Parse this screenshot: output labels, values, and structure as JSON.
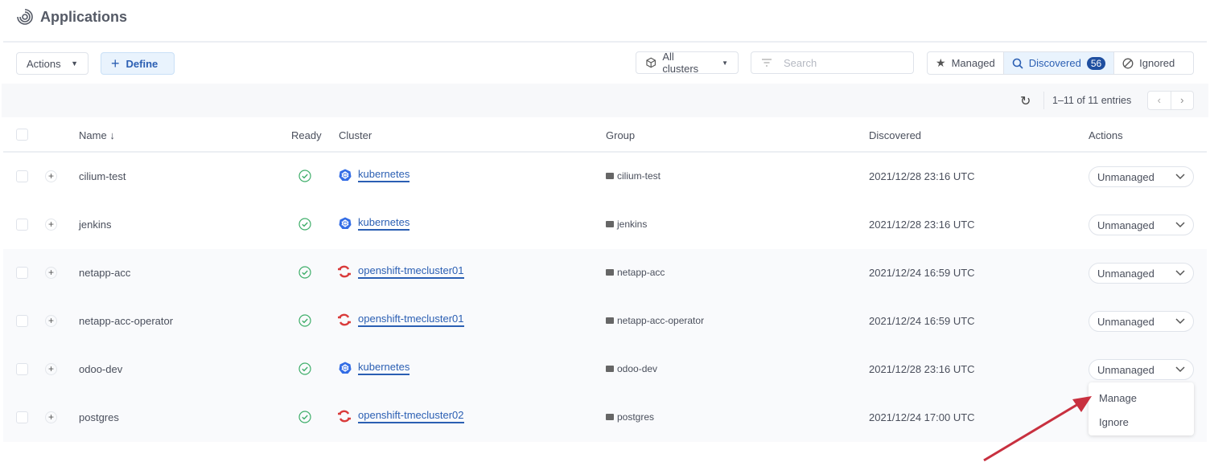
{
  "header": {
    "title": "Applications"
  },
  "toolbar": {
    "actions_label": "Actions",
    "define_label": "Define",
    "cluster_filter": "All clusters",
    "search_placeholder": "Search"
  },
  "tabs": [
    {
      "label": "Managed"
    },
    {
      "label": "Discovered",
      "count": "56"
    },
    {
      "label": "Ignored"
    }
  ],
  "pagination": {
    "entries": "1–11 of 11 entries"
  },
  "columns": {
    "name": "Name",
    "ready": "Ready",
    "cluster": "Cluster",
    "group": "Group",
    "discovered": "Discovered",
    "actions": "Actions"
  },
  "rows": [
    {
      "name": "cilium-test",
      "cluster": "kubernetes",
      "cluster_type": "kubernetes",
      "group": "cilium-test",
      "discovered": "2021/12/28 23:16 UTC",
      "action": "Unmanaged"
    },
    {
      "name": "jenkins",
      "cluster": "kubernetes",
      "cluster_type": "kubernetes",
      "group": "jenkins",
      "discovered": "2021/12/28 23:16 UTC",
      "action": "Unmanaged"
    },
    {
      "name": "netapp-acc",
      "cluster": "openshift-tmecluster01",
      "cluster_type": "openshift",
      "group": "netapp-acc",
      "discovered": "2021/12/24 16:59 UTC",
      "action": "Unmanaged"
    },
    {
      "name": "netapp-acc-operator",
      "cluster": "openshift-tmecluster01",
      "cluster_type": "openshift",
      "group": "netapp-acc-operator",
      "discovered": "2021/12/24 16:59 UTC",
      "action": "Unmanaged"
    },
    {
      "name": "odoo-dev",
      "cluster": "kubernetes",
      "cluster_type": "kubernetes",
      "group": "odoo-dev",
      "discovered": "2021/12/28 23:16 UTC",
      "action": "Unmanaged"
    },
    {
      "name": "postgres",
      "cluster": "openshift-tmecluster02",
      "cluster_type": "openshift",
      "group": "postgres",
      "discovered": "2021/12/24 17:00 UTC",
      "action": ""
    }
  ],
  "dropdown_menu": {
    "items": [
      "Manage",
      "Ignore"
    ]
  },
  "colors": {
    "accent": "#2b5fb3",
    "ready": "#3fae6a",
    "openshift": "#d93b3b",
    "kubernetes": "#326ce5",
    "annotation_arrow": "#c8303f"
  }
}
